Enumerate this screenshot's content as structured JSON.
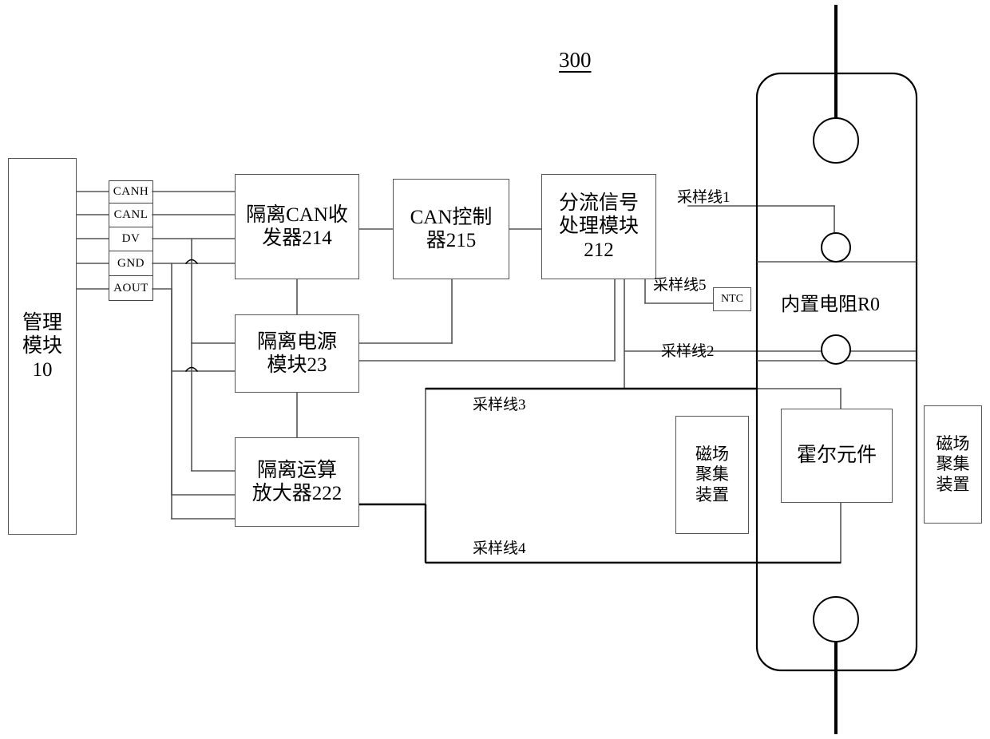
{
  "figure": {
    "number": "300"
  },
  "blocks": {
    "management_module": "管理\n模块\n10",
    "iso_can_transceiver": "隔离CAN收\n发器214",
    "can_controller": "CAN控制\n器215",
    "shunt_signal_module": "分流信号\n处理模块\n212",
    "iso_power_module": "隔离电源\n模块23",
    "iso_op_amp": "隔离运算\n放大器222",
    "hall_element": "霍尔元件",
    "mag_concentrator_left": "磁场\n聚集\n装置",
    "mag_concentrator_right": "磁场\n聚集\n装置",
    "ntc": "NTC",
    "builtin_resistor": "内置电阻R0"
  },
  "connector_pins": [
    {
      "label": "CANH"
    },
    {
      "label": "CANL"
    },
    {
      "label": "DV"
    },
    {
      "label": "GND"
    },
    {
      "label": "AOUT"
    }
  ],
  "sampling_lines": [
    {
      "label": "采样线1"
    },
    {
      "label": "采样线5"
    },
    {
      "label": "采样线2"
    },
    {
      "label": "采样线3"
    },
    {
      "label": "采样线4"
    }
  ],
  "colors": {
    "ink": "#000000",
    "box_stroke": "#555555",
    "wire": "#555555",
    "heavy_wire": "#000000",
    "background": "#ffffff"
  }
}
